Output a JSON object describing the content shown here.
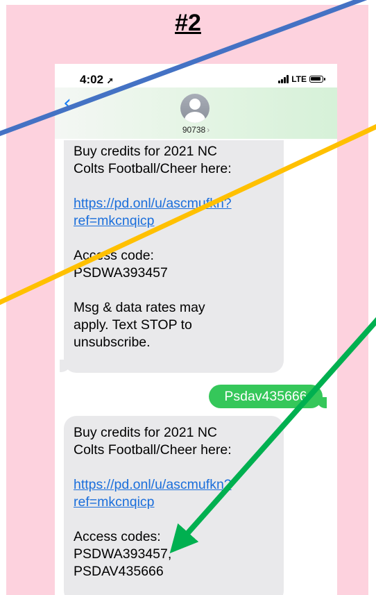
{
  "slide": {
    "title": "#2",
    "background_color": "#fdd2de"
  },
  "status_bar": {
    "time": "4:02",
    "location_icon": "location-arrow-icon",
    "network": "LTE",
    "signal_icon": "signal-bars-icon",
    "battery_icon": "battery-icon"
  },
  "header": {
    "back_icon": "chevron-left-icon",
    "avatar_icon": "person-avatar-icon",
    "contact": "90738",
    "contact_chevron": "›"
  },
  "messages": [
    {
      "type": "received",
      "line1": "Buy credits for 2021 NC",
      "line2": "Colts Football/Cheer here:",
      "link1": "https://pd.onl/u/ascmufkn?",
      "link2": "ref=mkcnqicp",
      "code_label": "Access code:",
      "code1": "PSDWA393457",
      "footer1": "Msg & data rates may",
      "footer2": "apply. Text STOP to",
      "footer3": "unsubscribe."
    },
    {
      "type": "sent",
      "text": "Psdav435666"
    },
    {
      "type": "received",
      "line1": "Buy credits for 2021 NC",
      "line2": "Colts Football/Cheer here:",
      "link1": "https://pd.onl/u/ascmufkn?",
      "link2": "ref=mkcnqicp",
      "code_label": "Access codes:",
      "code1": "PSDWA393457,",
      "code2": "PSDAV435666"
    }
  ],
  "annotations": {
    "colors": {
      "blue": "#4472c4",
      "yellow": "#ffc000",
      "green": "#00b050",
      "sent_bubble": "#35c75a",
      "received_bubble": "#e9e9eb",
      "link": "#1a6edb"
    }
  }
}
